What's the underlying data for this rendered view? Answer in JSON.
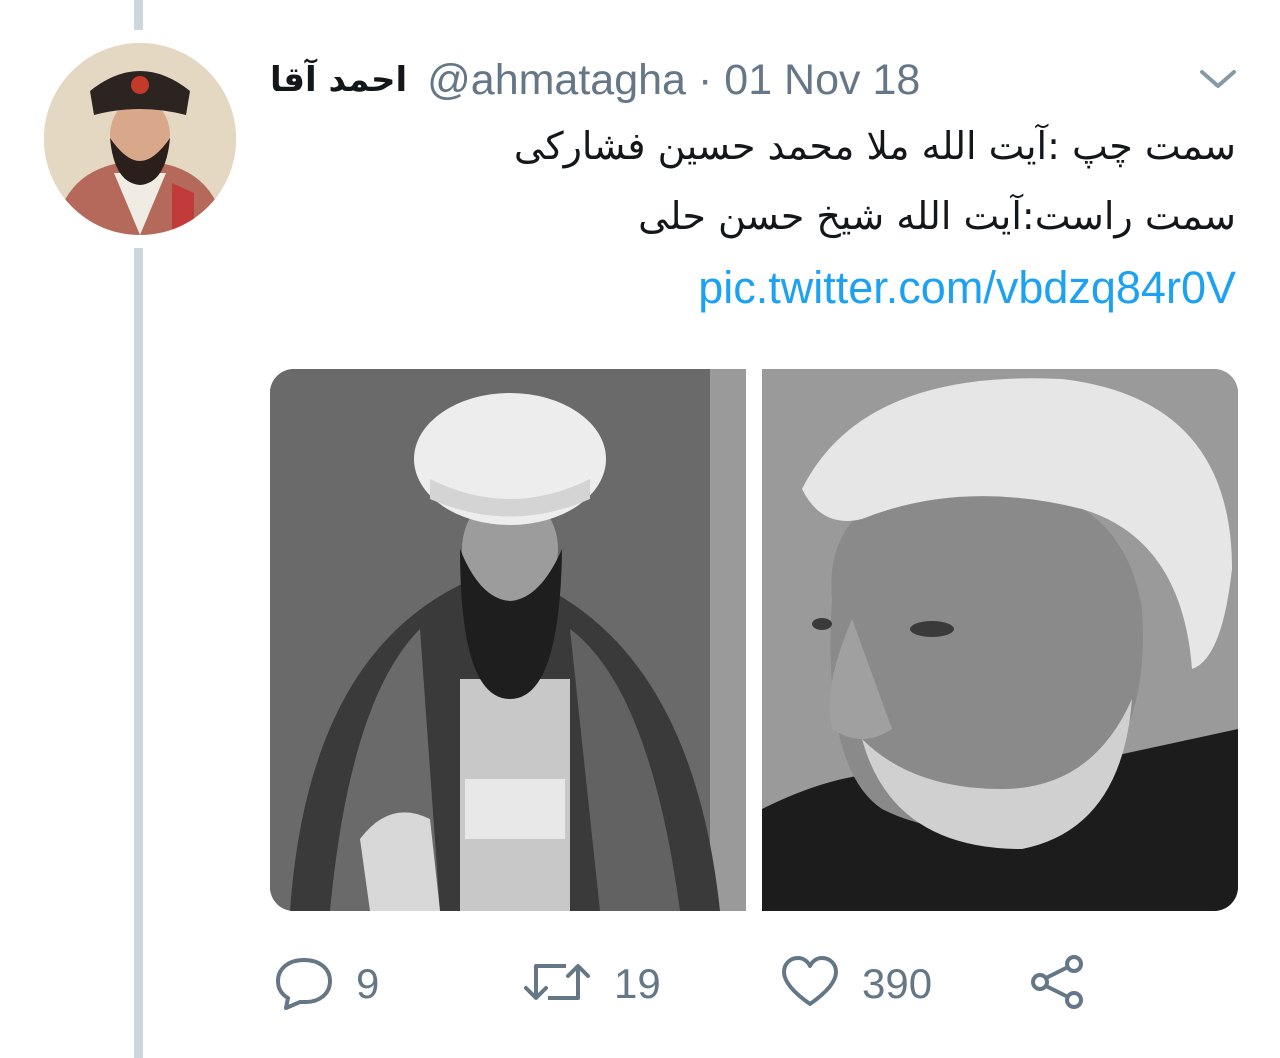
{
  "tweet": {
    "author": {
      "display_name": "احمد آقا",
      "handle": "@ahmatagha"
    },
    "separator": "·",
    "date": "01 Nov 18",
    "text_lines": [
      "سمت چپ :آیت الله ملا محمد حسین فشارکی",
      "سمت راست:آیت الله شیخ حسن حلی"
    ],
    "link": "pic.twitter.com/vbdzq84r0V",
    "media_count": 2
  },
  "actions": {
    "reply": {
      "icon": "reply-icon",
      "count": "9"
    },
    "retweet": {
      "icon": "retweet-icon",
      "count": "19"
    },
    "like": {
      "icon": "heart-icon",
      "count": "390"
    },
    "share": {
      "icon": "share-icon"
    }
  },
  "colors": {
    "text": "#14171a",
    "muted": "#657786",
    "link": "#1da1f2",
    "thread_line": "#ccd6dd"
  }
}
